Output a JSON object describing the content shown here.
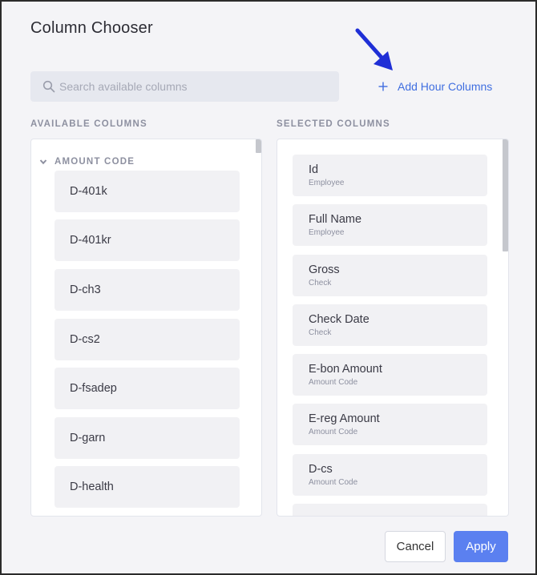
{
  "dialog": {
    "title": "Column Chooser"
  },
  "search": {
    "placeholder": "Search available columns",
    "icon": "search-icon"
  },
  "add_hour_columns": {
    "label": "Add Hour Columns",
    "icon": "plus-icon",
    "color": "#3f6ee0"
  },
  "annotation": {
    "icon": "arrow-icon",
    "color": "#1f2fd6"
  },
  "available": {
    "heading": "AVAILABLE COLUMNS",
    "group": {
      "label": "AMOUNT CODE",
      "icon": "chevron-down-icon",
      "items": [
        "D-401k",
        "D-401kr",
        "D-ch3",
        "D-cs2",
        "D-fsadep",
        "D-garn",
        "D-health"
      ]
    }
  },
  "selected": {
    "heading": "SELECTED COLUMNS",
    "items": [
      {
        "name": "Id",
        "source": "Employee"
      },
      {
        "name": "Full Name",
        "source": "Employee"
      },
      {
        "name": "Gross",
        "source": "Check"
      },
      {
        "name": "Check Date",
        "source": "Check"
      },
      {
        "name": "E-bon Amount",
        "source": "Amount Code"
      },
      {
        "name": "E-reg Amount",
        "source": "Amount Code"
      },
      {
        "name": "D-cs",
        "source": "Amount Code"
      },
      {
        "name": "",
        "source": ""
      }
    ]
  },
  "footer": {
    "cancel_label": "Cancel",
    "apply_label": "Apply",
    "accent": "#5b80f0"
  }
}
